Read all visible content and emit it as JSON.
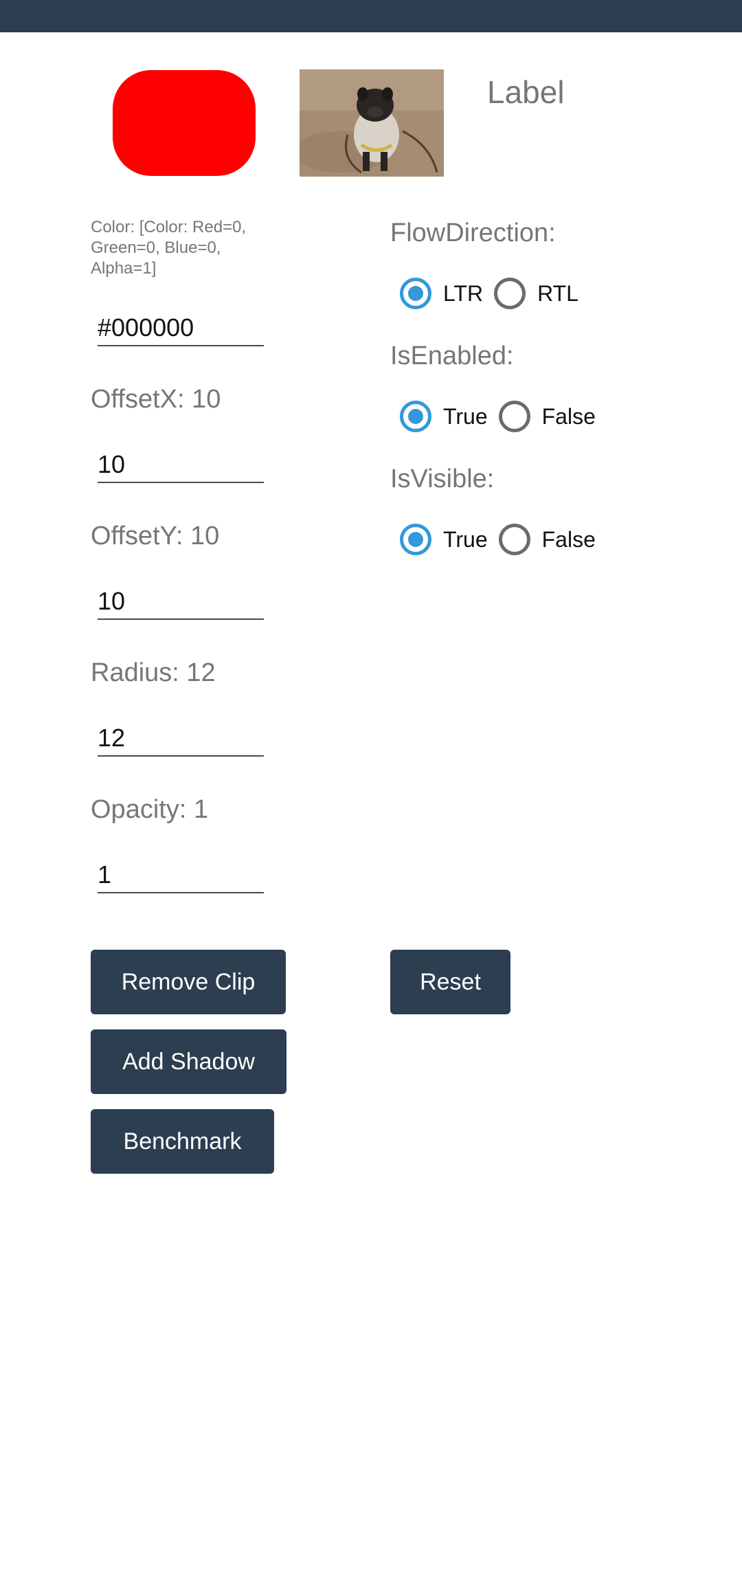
{
  "header": {
    "status_bar_color": "#2c3e50"
  },
  "preview": {
    "shape_color": "#ff0000",
    "image_alt": "pug-photo",
    "label": "Label"
  },
  "color_info": "Color: [Color: Red=0, Green=0, Blue=0, Alpha=1]",
  "fields": {
    "color_value": "#000000",
    "offset_x_label": "OffsetX: 10",
    "offset_x_value": "10",
    "offset_y_label": "OffsetY: 10",
    "offset_y_value": "10",
    "radius_label": "Radius: 12",
    "radius_value": "12",
    "opacity_label": "Opacity: 1",
    "opacity_value": "1"
  },
  "flow_direction": {
    "label": "FlowDirection:",
    "options": [
      "LTR",
      "RTL"
    ],
    "selected": "LTR"
  },
  "is_enabled": {
    "label": "IsEnabled:",
    "options": [
      "True",
      "False"
    ],
    "selected": "True"
  },
  "is_visible": {
    "label": "IsVisible:",
    "options": [
      "True",
      "False"
    ],
    "selected": "True"
  },
  "buttons": {
    "remove_clip": "Remove Clip",
    "reset": "Reset",
    "add_shadow": "Add Shadow",
    "benchmark": "Benchmark"
  },
  "accent_color": "#3498db",
  "button_color": "#2c3e50"
}
